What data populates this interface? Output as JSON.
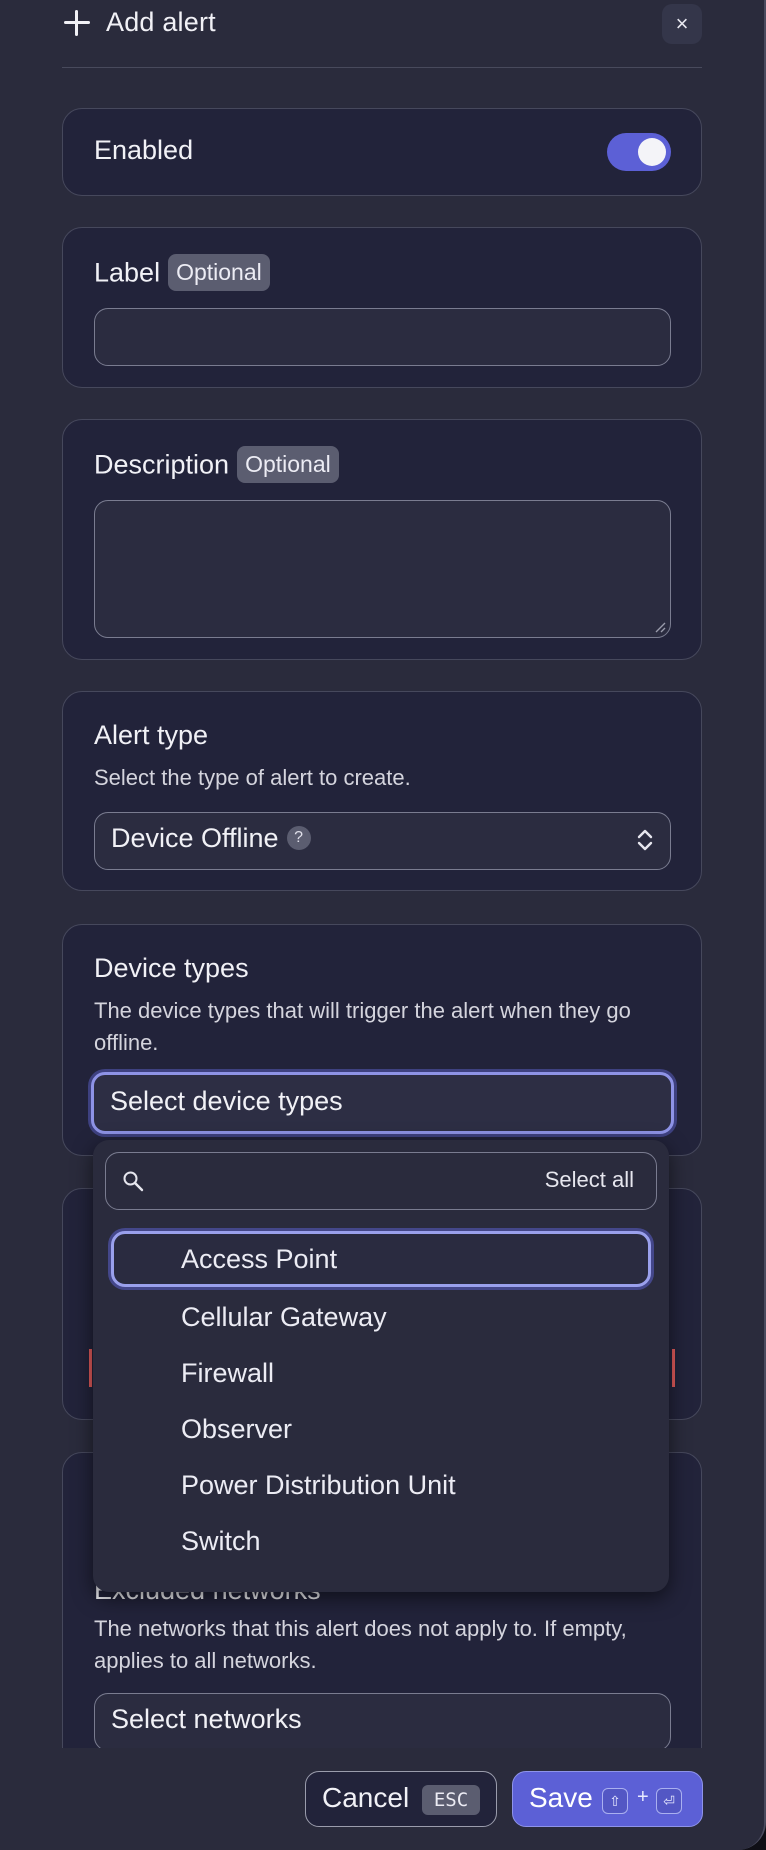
{
  "header": {
    "title": "Add alert",
    "close_label": "×"
  },
  "enabled": {
    "label": "Enabled",
    "toggle_on": true
  },
  "label_field": {
    "title": "Label",
    "badge": "Optional",
    "value": ""
  },
  "description_field": {
    "title": "Description",
    "badge": "Optional",
    "value": ""
  },
  "alert_type": {
    "title": "Alert type",
    "description": "Select the type of alert to create.",
    "selected": "Device Offline",
    "help": "?"
  },
  "device_types": {
    "title": "Device types",
    "description": "The device types that will trigger the alert when they go offline.",
    "placeholder": "Select device types",
    "search_placeholder": "",
    "select_all": "Select all",
    "options": [
      "Access Point",
      "Cellular Gateway",
      "Firewall",
      "Observer",
      "Power Distribution Unit",
      "Switch"
    ]
  },
  "excluded_networks": {
    "title": "Excluded networks",
    "description": "The networks that this alert does not apply to. If empty, applies to all networks.",
    "placeholder": "Select networks"
  },
  "footer": {
    "cancel": "Cancel",
    "cancel_key": "ESC",
    "save": "Save",
    "save_key_shift": "⇧",
    "save_key_plus": "+",
    "save_key_enter": "⏎"
  },
  "colors": {
    "accent": "#5c60d6",
    "panel": "#2a2b3c",
    "card": "#22233a",
    "error": "#e05a5a"
  }
}
